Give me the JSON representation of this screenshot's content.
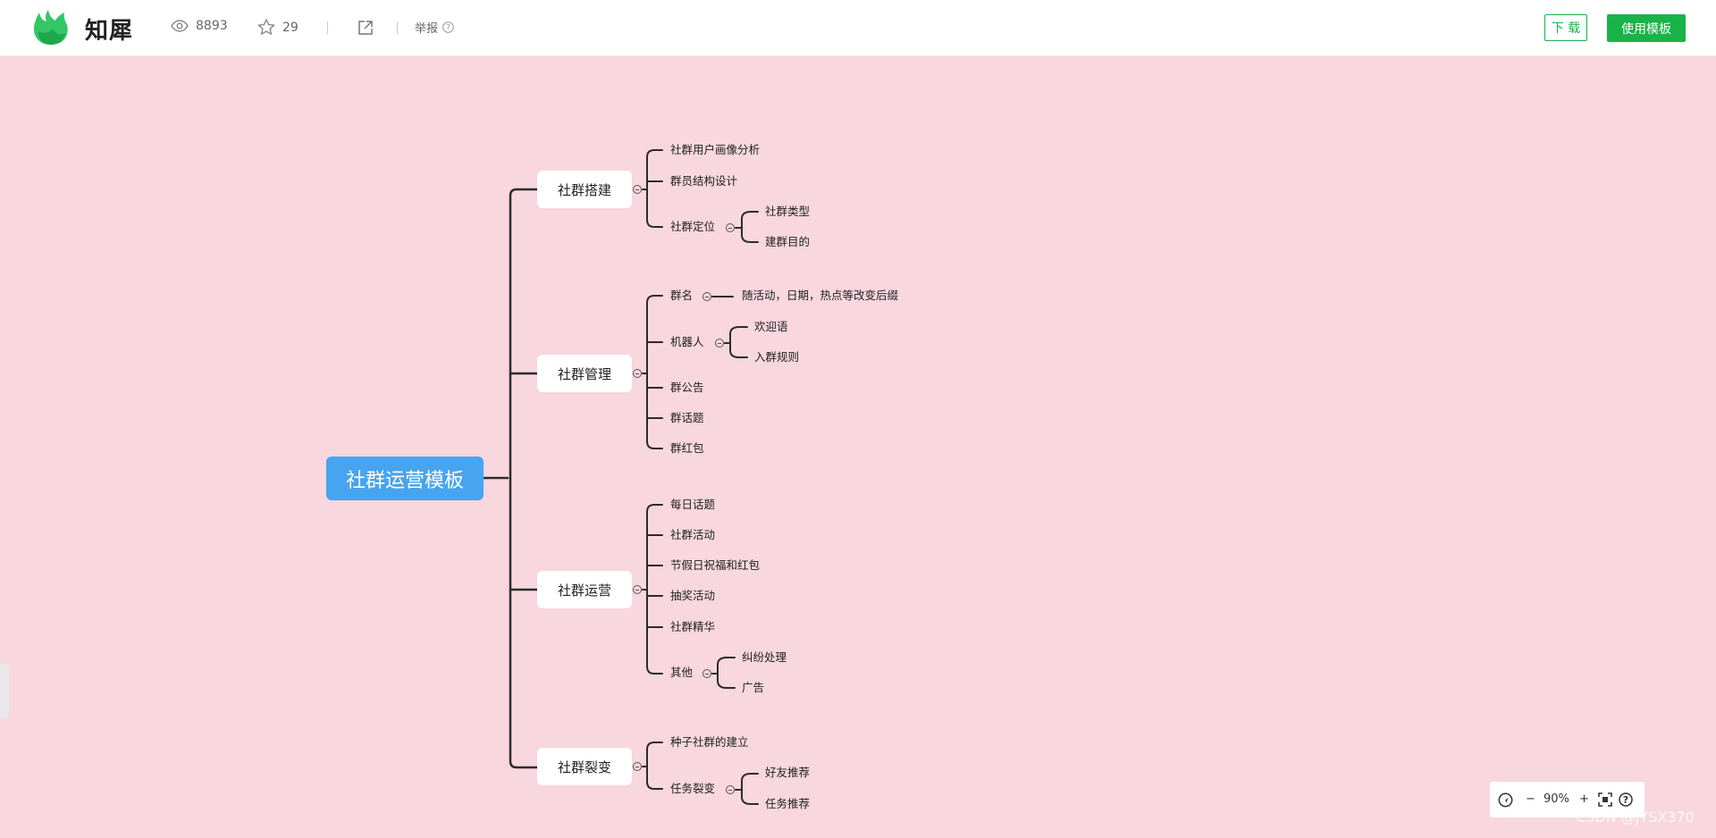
{
  "header": {
    "brand": "知犀",
    "views": "8893",
    "likes": "29",
    "report_label": "举报",
    "download_label": "下 载",
    "use_template_label": "使用模板"
  },
  "mindmap": {
    "root": "社群运营模板",
    "branches": [
      {
        "label": "社群搭建",
        "children": [
          {
            "label": "社群用户画像分析"
          },
          {
            "label": "群员结构设计"
          },
          {
            "label": "社群定位",
            "children": [
              {
                "label": "社群类型"
              },
              {
                "label": "建群目的"
              }
            ]
          }
        ]
      },
      {
        "label": "社群管理",
        "children": [
          {
            "label": "群名",
            "children": [
              {
                "label": "随活动，日期，热点等改变后缀"
              }
            ]
          },
          {
            "label": "机器人",
            "children": [
              {
                "label": "欢迎语"
              },
              {
                "label": "入群规则"
              }
            ]
          },
          {
            "label": "群公告"
          },
          {
            "label": "群话题"
          },
          {
            "label": "群红包"
          }
        ]
      },
      {
        "label": "社群运营",
        "children": [
          {
            "label": "每日话题"
          },
          {
            "label": "社群活动"
          },
          {
            "label": "节假日祝福和红包"
          },
          {
            "label": "抽奖活动"
          },
          {
            "label": "社群精华"
          },
          {
            "label": "其他",
            "children": [
              {
                "label": "纠纷处理"
              },
              {
                "label": "广告"
              }
            ]
          }
        ]
      },
      {
        "label": "社群裂变",
        "children": [
          {
            "label": "种子社群的建立"
          },
          {
            "label": "任务裂变",
            "children": [
              {
                "label": "好友推荐"
              },
              {
                "label": "任务推荐"
              }
            ]
          }
        ]
      }
    ]
  },
  "zoom": {
    "minus": "−",
    "level": "90%",
    "plus": "+",
    "help": "?"
  },
  "watermark": "CSDN @JYSX370",
  "colors": {
    "canvas": "#f8d7df",
    "root": "#47a4ef",
    "accent": "#19b34a",
    "line": "#2b2b2b"
  },
  "icons": [
    "app-logo-icon",
    "eye-icon",
    "star-icon",
    "external-link-icon",
    "question-icon",
    "locate-icon",
    "fit-screen-icon",
    "help-icon"
  ]
}
